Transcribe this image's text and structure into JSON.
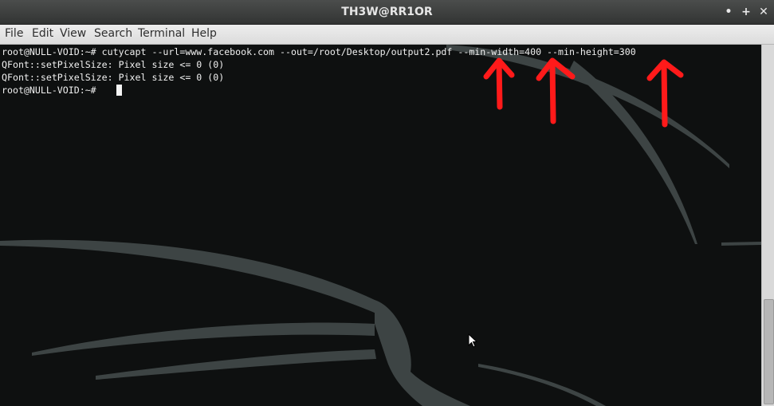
{
  "window": {
    "title": "TH3W@RR1OR"
  },
  "controls": {
    "minimize": "•",
    "maximize": "+",
    "close": "✕"
  },
  "menu": {
    "items": [
      "File",
      "Edit",
      "View",
      "Search",
      "Terminal",
      "Help"
    ]
  },
  "terminal": {
    "lines": [
      "root@NULL-VOID:~# cutycapt --url=www.facebook.com --out=/root/Desktop/output2.pdf --min-width=400 --min-height=300",
      "QFont::setPixelSize: Pixel size <= 0 (0)",
      "QFont::setPixelSize: Pixel size <= 0 (0)",
      "root@NULL-VOID:~# "
    ]
  },
  "colors": {
    "arrow": "#ff1a1a",
    "terminal_bg": "#0e1010",
    "dragon": "#3d4444"
  },
  "icons": {
    "cursor": "mouse-pointer-icon",
    "annotation": "up-arrow-icon"
  }
}
